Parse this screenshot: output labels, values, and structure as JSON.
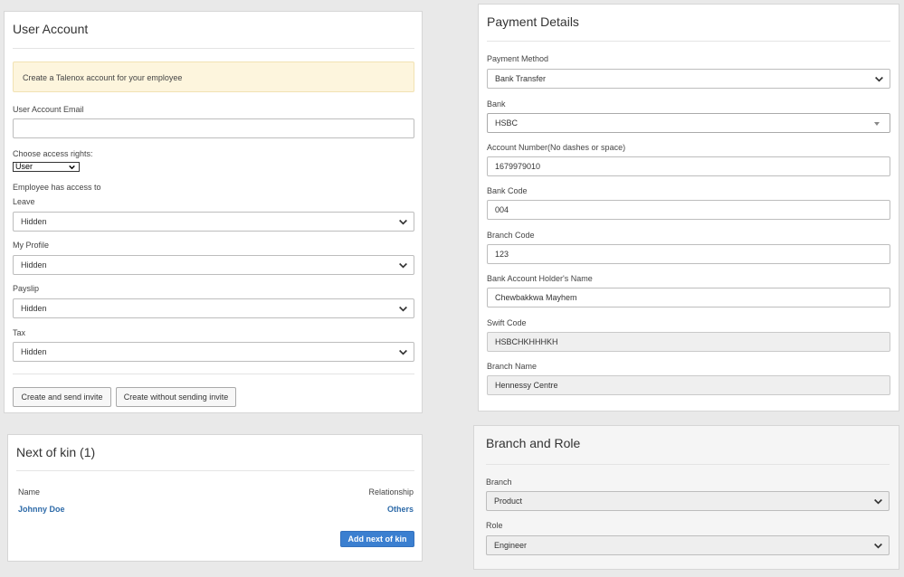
{
  "user_account": {
    "title": "User Account",
    "notice": "Create a Talenox account for your employee",
    "email_label": "User Account Email",
    "email_value": "",
    "access_rights_label": "Choose access rights:",
    "access_rights_value": "User",
    "access_heading": "Employee has access to",
    "access_items": [
      {
        "label": "Leave",
        "value": "Hidden"
      },
      {
        "label": "My Profile",
        "value": "Hidden"
      },
      {
        "label": "Payslip",
        "value": "Hidden"
      },
      {
        "label": "Tax",
        "value": "Hidden"
      }
    ],
    "create_send_label": "Create and send invite",
    "create_nosend_label": "Create without sending invite"
  },
  "next_of_kin": {
    "title": "Next of kin (1)",
    "col_name": "Name",
    "col_relationship": "Relationship",
    "rows": [
      {
        "name": "Johnny Doe",
        "relationship": "Others"
      }
    ],
    "add_label": "Add next of kin"
  },
  "payment_details": {
    "title": "Payment Details",
    "payment_method_label": "Payment Method",
    "payment_method_value": "Bank Transfer",
    "bank_label": "Bank",
    "bank_value": "HSBC",
    "account_number_label": "Account Number(No dashes or space)",
    "account_number_value": "1679979010",
    "bank_code_label": "Bank Code",
    "bank_code_value": "004",
    "branch_code_label": "Branch Code",
    "branch_code_value": "123",
    "holder_label": "Bank Account Holder's Name",
    "holder_value": "Chewbakkwa Mayhem",
    "swift_label": "Swift Code",
    "swift_value": "HSBCHKHHHKH",
    "branch_name_label": "Branch Name",
    "branch_name_value": "Hennessy Centre"
  },
  "branch_role": {
    "title": "Branch and Role",
    "branch_label": "Branch",
    "branch_value": "Product",
    "role_label": "Role",
    "role_value": "Engineer"
  },
  "icons": {
    "dropdown": "chevron-down-icon",
    "select_caret": "caret-down-icon"
  }
}
